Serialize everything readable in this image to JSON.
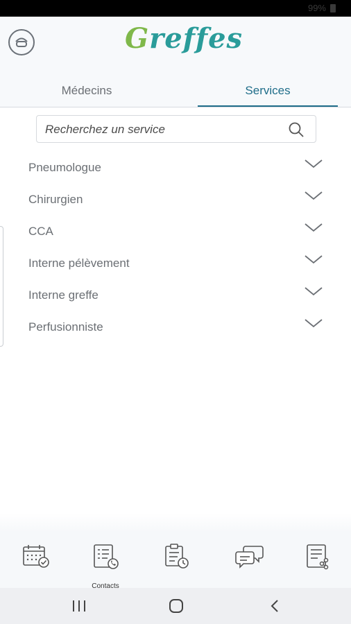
{
  "status_bar": {
    "battery": "99%"
  },
  "header": {
    "logo_text": "Greffes",
    "tabs": [
      {
        "label": "Médecins",
        "active": false
      },
      {
        "label": "Services",
        "active": true
      }
    ]
  },
  "search": {
    "placeholder": "Recherchez un service",
    "value": ""
  },
  "services": [
    {
      "label": "Pneumologue"
    },
    {
      "label": "Chirurgien"
    },
    {
      "label": "CCA"
    },
    {
      "label": "Interne pélèvement"
    },
    {
      "label": "Interne greffe"
    },
    {
      "label": "Perfusionniste"
    }
  ],
  "bottom_nav": {
    "items": [
      {
        "icon": "calendar-check-icon",
        "label": ""
      },
      {
        "icon": "contacts-icon",
        "label": "Contacts"
      },
      {
        "icon": "clipboard-clock-icon",
        "label": ""
      },
      {
        "icon": "chat-bubbles-icon",
        "label": ""
      },
      {
        "icon": "document-share-icon",
        "label": ""
      }
    ]
  },
  "system_nav": [
    "recent-apps-icon",
    "home-icon",
    "back-icon"
  ],
  "colors": {
    "accent": "#1f6d89",
    "logo_green": "#7fb84a",
    "logo_teal": "#2a9c9a",
    "text_gray": "#6b6f74"
  }
}
